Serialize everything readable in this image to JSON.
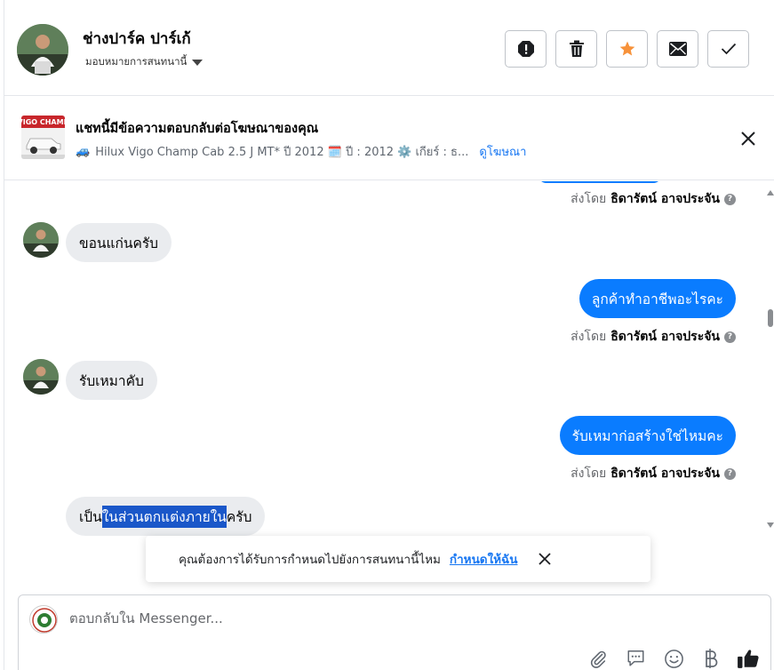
{
  "header": {
    "contact_name": "ช่างปาร์ค ปาร์เก้",
    "assign_label": "มอบหมายการสนทนานี้"
  },
  "ad": {
    "title": "แชทนี้มีข้อความตอบกลับต่อโฆษณาของคุณ",
    "description": "Hilux Vigo Champ Cab 2.5 J MT* ปี 2012 🗓️ ปี : 2012 ⚙️ เกียร์ : ธ...",
    "vehicle_icon": "🚙",
    "view_ad_link": "ดูโฆษณา",
    "thumb_text": "VIGO CHAMP"
  },
  "sent_by": {
    "prefix": "ส่งโดย",
    "name": "ธิดารัตน์ อาจประจัน"
  },
  "messages": [
    {
      "direction": "in",
      "text": "ขอนแก่นครับ"
    },
    {
      "direction": "out",
      "text": "ลูกค้าทำอาชีพอะไรคะ"
    },
    {
      "direction": "in",
      "text": "รับเหมาคับ"
    },
    {
      "direction": "out",
      "text": "รับเหมาก่อสร้างใช่ไหมคะ"
    },
    {
      "direction": "in",
      "text_before": "เป็น",
      "text_selected": "ในส่วนตกแต่งภายใน",
      "text_after": "ครับ"
    }
  ],
  "toast": {
    "text": "คุณต้องการได้รับการกำหนดไปยังการสนทนานี้ไหม",
    "link": "กำหนดให้ฉัน"
  },
  "composer": {
    "placeholder": "ตอบกลับใน Messenger..."
  },
  "colors": {
    "outgoing_bubble": "#0a7cff",
    "incoming_bubble": "#eaecef",
    "link": "#1877f2",
    "star": "#f7923a"
  }
}
